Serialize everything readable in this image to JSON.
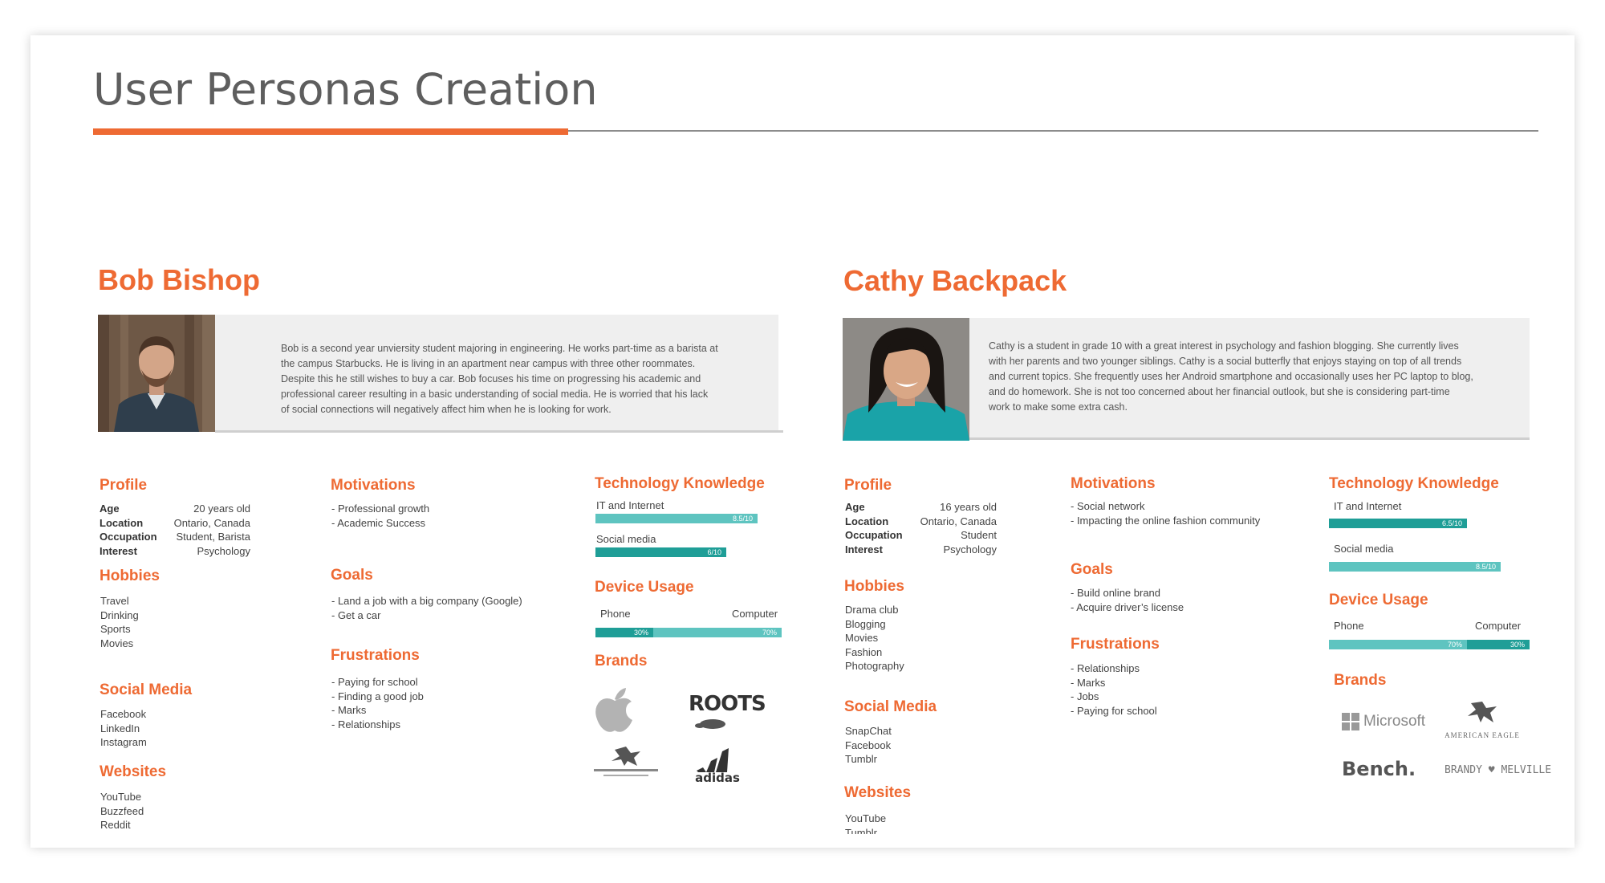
{
  "page": {
    "title": "User Personas Creation"
  },
  "colors": {
    "accent": "#ee6a33",
    "teal_light": "#5ec4c0",
    "teal_dark": "#1f9e97",
    "gray_bg": "#efefef"
  },
  "personas": [
    {
      "name": "Bob Bishop",
      "bio": [
        "Bob is a second year unviersity student majoring in engineering. He works part-time as a barista at",
        "the campus Starbucks. He is living in an apartment near campus with three other roommates.",
        "Despite this he still wishes to buy a car. Bob focuses his time on  progressing his academic and",
        "professional career resulting in a basic understanding of  social media. He is worried that his lack",
        "of social connections will negatively affect him  when he is looking for work."
      ],
      "profile": {
        "heading": "Profile",
        "rows": [
          {
            "label": "Age",
            "value": "20 years old"
          },
          {
            "label": "Location",
            "value": "Ontario, Canada"
          },
          {
            "label": "Occupation",
            "value": "Student, Barista"
          },
          {
            "label": "Interest",
            "value": "Psychology"
          }
        ]
      },
      "hobbies": {
        "heading": "Hobbies",
        "items": [
          "Travel",
          "Drinking",
          "Sports",
          "Movies"
        ]
      },
      "social_media": {
        "heading": "Social Media",
        "items": [
          "Facebook",
          "LinkedIn",
          "Instagram"
        ]
      },
      "websites": {
        "heading": "Websites",
        "items": [
          "YouTube",
          "Buzzfeed",
          "Reddit"
        ]
      },
      "motivations": {
        "heading": "Motivations",
        "items": [
          "- Professional growth",
          "- Academic Success"
        ]
      },
      "goals": {
        "heading": "Goals",
        "items": [
          "- Land a job with a big company (Google)",
          "- Get a car"
        ]
      },
      "frustrations": {
        "heading": "Frustrations",
        "items": [
          "- Paying for school",
          "- Finding a good job",
          "- Marks",
          "- Relationships"
        ]
      },
      "technology": {
        "heading": "Technology Knowledge",
        "items": [
          {
            "label": "IT and Internet",
            "value": 8.5,
            "text": "8.5/10"
          },
          {
            "label": "Social media",
            "value": 6,
            "text": "6/10"
          }
        ]
      },
      "device_usage": {
        "heading": "Device Usage",
        "phone_label": "Phone",
        "computer_label": "Computer",
        "phone_pct": 30,
        "computer_pct": 70,
        "phone_text": "30%",
        "computer_text": "70%"
      },
      "brands": {
        "heading": "Brands",
        "items": [
          "apple",
          "ROOTS",
          "american-eagle",
          "adidas"
        ]
      }
    },
    {
      "name": "Cathy Backpack",
      "bio": [
        "Cathy is a student in grade 10 with a great interest in psychology and fashion blogging. She currently lives",
        "with her parents and two younger siblings. Cathy is a social butterfly that enjoys staying on top of all trends",
        "and current topics. She frequently uses her Android smartphone and occasionally  uses her PC laptop to blog,",
        "and do homework. She is not too concerned about her financial outlook, but she is considering part-time",
        " work to make some extra cash."
      ],
      "profile": {
        "heading": "Profile",
        "rows": [
          {
            "label": "Age",
            "value": "16 years old"
          },
          {
            "label": "Location",
            "value": "Ontario, Canada"
          },
          {
            "label": "Occupation",
            "value": "Student"
          },
          {
            "label": "Interest",
            "value": "Psychology"
          }
        ]
      },
      "hobbies": {
        "heading": "Hobbies",
        "items": [
          "Drama club",
          "Blogging",
          "Movies",
          "Fashion",
          "Photography"
        ]
      },
      "social_media": {
        "heading": "Social Media",
        "items": [
          "SnapChat",
          "Facebook",
          "Tumblr"
        ]
      },
      "websites": {
        "heading": "Websites",
        "items": [
          "YouTube",
          "Tumblr"
        ]
      },
      "motivations": {
        "heading": "Motivations",
        "items": [
          "- Social network",
          "- Impacting the online fashion community"
        ]
      },
      "goals": {
        "heading": "Goals",
        "items": [
          "- Build online brand",
          "- Acquire driver’s license"
        ]
      },
      "frustrations": {
        "heading": "Frustrations",
        "items": [
          "- Relationships",
          "- Marks",
          "- Jobs",
          "- Paying for school"
        ]
      },
      "technology": {
        "heading": "Technology Knowledge",
        "items": [
          {
            "label": "IT and Internet",
            "value": 6.5,
            "text": "6.5/10"
          },
          {
            "label": "Social media",
            "value": 8.5,
            "text": "8.5/10"
          }
        ]
      },
      "device_usage": {
        "heading": "Device Usage",
        "phone_label": "Phone",
        "computer_label": "Computer",
        "phone_pct": 70,
        "computer_pct": 30,
        "phone_text": "70%",
        "computer_text": "30%"
      },
      "brands": {
        "heading": "Brands",
        "items": [
          "Microsoft",
          "AMERICAN EAGLE",
          "Bench.",
          "BRANDY ♥ MELVILLE"
        ]
      }
    }
  ]
}
